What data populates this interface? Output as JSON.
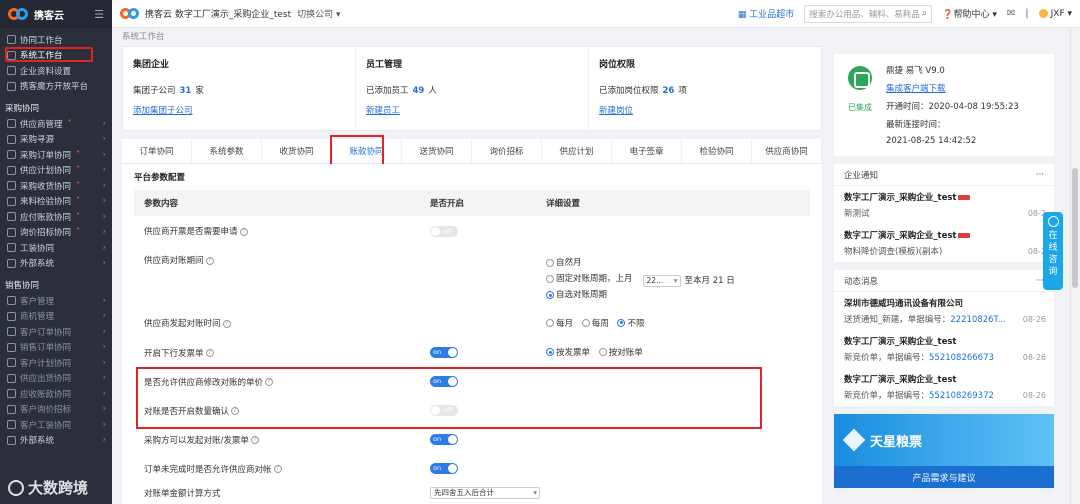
{
  "sidebar": {
    "brand": "携客云",
    "items_top": [
      {
        "label": "协同工作台"
      },
      {
        "label": "系统工作台"
      },
      {
        "label": "企业资料设置"
      },
      {
        "label": "携客魔方开放平台"
      }
    ],
    "group_purchase": "采购协同",
    "items_purchase": [
      {
        "label": "供应商管理",
        "dot": "•"
      },
      {
        "label": "采购寻源"
      },
      {
        "label": "采购订单协同",
        "dot": "•"
      },
      {
        "label": "供应计划协同",
        "dot": "•"
      },
      {
        "label": "采购收货协同",
        "dot": "•"
      },
      {
        "label": "来料检验协同",
        "dot": "•"
      },
      {
        "label": "应付账款协同",
        "dot": "•"
      },
      {
        "label": "询价招标协同",
        "dot": "•"
      },
      {
        "label": "工装协同"
      },
      {
        "label": "外部系统"
      }
    ],
    "group_sales": "销售协同",
    "items_sales": [
      {
        "label": "客户管理"
      },
      {
        "label": "商机管理"
      },
      {
        "label": "客户订单协同"
      },
      {
        "label": "销售订单协同"
      },
      {
        "label": "客户计划协同"
      },
      {
        "label": "供应出货协同"
      },
      {
        "label": "应收账款协同"
      },
      {
        "label": "客户询价招标"
      },
      {
        "label": "客户工装协同"
      },
      {
        "label": "外部系统"
      }
    ],
    "watermark": "大数跨境"
  },
  "topbar": {
    "title": "携客云 数字工厂演示_采购企业_test",
    "switch": "切换公司 ▾",
    "mall": "工业品超市",
    "search_placeholder": "搜索办公用品、辅料、易耗品",
    "help": "帮助中心",
    "user": "JXF ▾"
  },
  "breadcrumb": "系统工作台",
  "cards": [
    {
      "title": "集团企业",
      "text": "集团子公司",
      "num": "31",
      "unit": "家",
      "link": "添加集团子公司"
    },
    {
      "title": "员工管理",
      "text": "已添加员工",
      "num": "49",
      "unit": "人",
      "link": "新建员工"
    },
    {
      "title": "岗位权限",
      "text": "已添加岗位权限",
      "num": "26",
      "unit": "项",
      "link": "新建岗位"
    }
  ],
  "tabs": [
    "订单协同",
    "系统参数",
    "收货协同",
    "账款协同",
    "送货协同",
    "询价招标",
    "供应计划",
    "电子签章",
    "检验协同",
    "供应商协同"
  ],
  "panel": {
    "title": "平台参数配置",
    "col_param": "参数内容",
    "col_enable": "是否开启",
    "col_detail": "详细设置",
    "rows": {
      "r1": "供应商开票是否需要申请",
      "r2": "供应商对账期间",
      "r2_opt1": "自然月",
      "r2_opt2": "固定对账周期，上月",
      "r2_sel": "22...",
      "r2_tail": "至本月 21 日",
      "r2_opt3": "自选对账周期",
      "r3": "供应商发起对账时间",
      "r3_o1": "每月",
      "r3_o2": "每周",
      "r3_o3": "不限",
      "r4": "开启下行发票单",
      "r4_o1": "按发票单",
      "r4_o2": "按对账单",
      "r5": "是否允许供应商修改对账的单价",
      "r6": "对账是否开启数量确认",
      "r7": "采购方可以发起对账/发票单",
      "r8": "订单未完成时是否允许供应商对帐",
      "r9": "对账单金额计算方式",
      "r9_sel": "先四舍五入后合计",
      "on": "on",
      "off": "off"
    }
  },
  "system": {
    "product": "鼎捷 易飞 V9.0",
    "download": "集成客户端下载",
    "status": "已集成",
    "open_label": "开通时间：",
    "open_time": "2020-04-08 19:55:23",
    "last_label": "最新连接时间：",
    "last_time": "2021-08-25 14:42:52"
  },
  "notice": {
    "title": "企业通知",
    "more": "···",
    "items": [
      {
        "t": "数字工厂演示_采购企业_test",
        "d": "新测试",
        "dt": "08-2"
      },
      {
        "t": "数字工厂演示_采购企业_test",
        "d": "物料降价调查(模板)(副本)",
        "dt": "08-2"
      }
    ]
  },
  "news": {
    "title": "动态消息",
    "more": "···",
    "items": [
      {
        "t": "深圳市德威玛通讯设备有限公司",
        "d": "送货通知_新建，单据编号：",
        "code": "22210826T...",
        "dt": "08-26"
      },
      {
        "t": "数字工厂演示_采购企业_test",
        "d": "新竞价单，单据编号：",
        "code": "552108266673",
        "dt": "08-26"
      },
      {
        "t": "数字工厂演示_采购企业_test",
        "d": "新竞价单，单据编号：",
        "code": "552108269372",
        "dt": "08-26"
      }
    ]
  },
  "banner": {
    "name": "天星粮票",
    "bottom": "产品需求与建议"
  },
  "float_help": "在线咨询"
}
